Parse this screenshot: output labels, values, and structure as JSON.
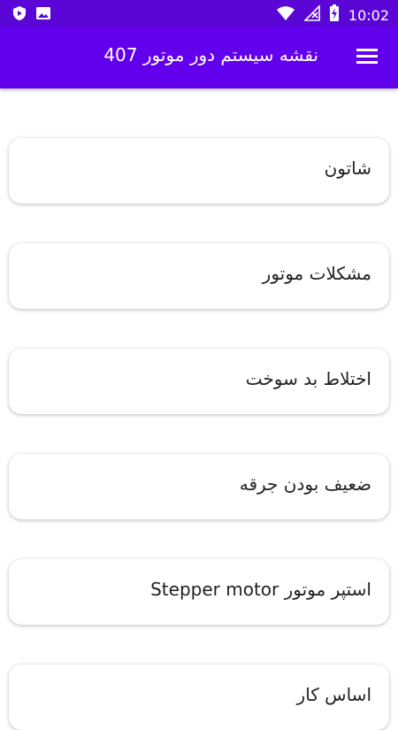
{
  "status_bar": {
    "time": "10:02",
    "icons": [
      "play-protect-icon",
      "image-icon",
      "wifi-icon",
      "no-signal-icon",
      "battery-charging-icon"
    ]
  },
  "app_bar": {
    "title": "نقشه سیستم دور موتور 407",
    "menu_icon": "hamburger-menu-icon"
  },
  "menu_items": [
    {
      "label": "شاتون"
    },
    {
      "label": "مشکلات موتور"
    },
    {
      "label": "اختلاط بد سوخت"
    },
    {
      "label": "ضعیف بودن جرقه"
    },
    {
      "label": "استپر موتور Stepper motor"
    },
    {
      "label": "اساس کار"
    }
  ],
  "colors": {
    "status_bar": "#5a06d6",
    "app_bar": "#6200ee",
    "card_background": "#ffffff",
    "text": "#222222"
  }
}
